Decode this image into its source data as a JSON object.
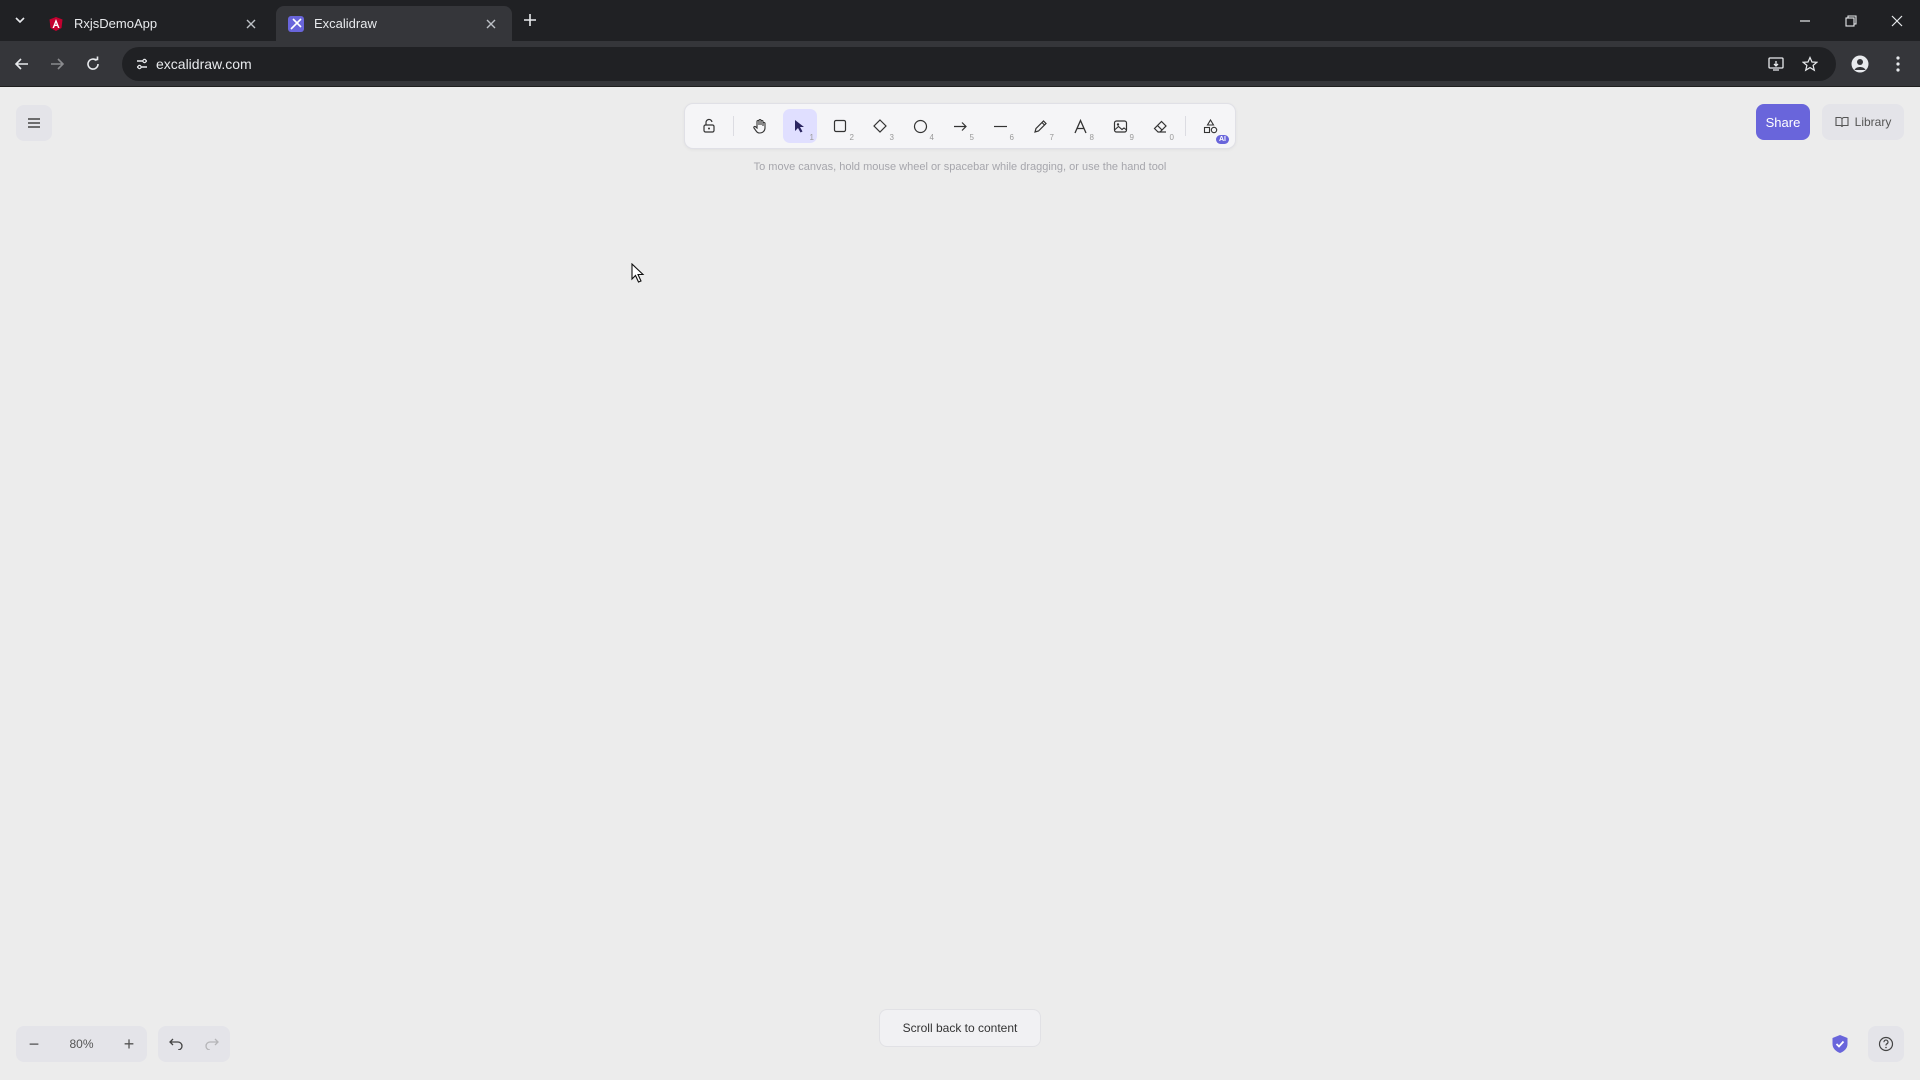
{
  "browser": {
    "tabs": [
      {
        "title": "RxjsDemoApp",
        "favicon": "angular-icon",
        "active": false
      },
      {
        "title": "Excalidraw",
        "favicon": "excalidraw-icon",
        "active": true
      }
    ],
    "url": "excalidraw.com",
    "window_controls": [
      "minimize-icon",
      "restore-icon",
      "close-icon"
    ]
  },
  "excalidraw": {
    "tools": [
      {
        "name": "lock",
        "key": ""
      },
      {
        "name": "hand",
        "key": ""
      },
      {
        "name": "selection",
        "key": "1",
        "selected": true
      },
      {
        "name": "rectangle",
        "key": "2"
      },
      {
        "name": "diamond",
        "key": "3"
      },
      {
        "name": "ellipse",
        "key": "4"
      },
      {
        "name": "arrow",
        "key": "5"
      },
      {
        "name": "line",
        "key": "6"
      },
      {
        "name": "draw",
        "key": "7"
      },
      {
        "name": "text",
        "key": "8"
      },
      {
        "name": "image",
        "key": "9"
      },
      {
        "name": "eraser",
        "key": "0"
      },
      {
        "name": "more-tools",
        "badge": "AI"
      }
    ],
    "hint": "To move canvas, hold mouse wheel or spacebar while dragging, or use the hand tool",
    "share_label": "Share",
    "library_label": "Library",
    "zoom": "80%",
    "zoom_out": "−",
    "zoom_in": "+",
    "scroll_back_label": "Scroll back to content"
  },
  "colors": {
    "accent": "#6965db",
    "canvas": "#ececec",
    "chrome_dark": "#202124",
    "chrome_toolbar": "#35363a"
  }
}
